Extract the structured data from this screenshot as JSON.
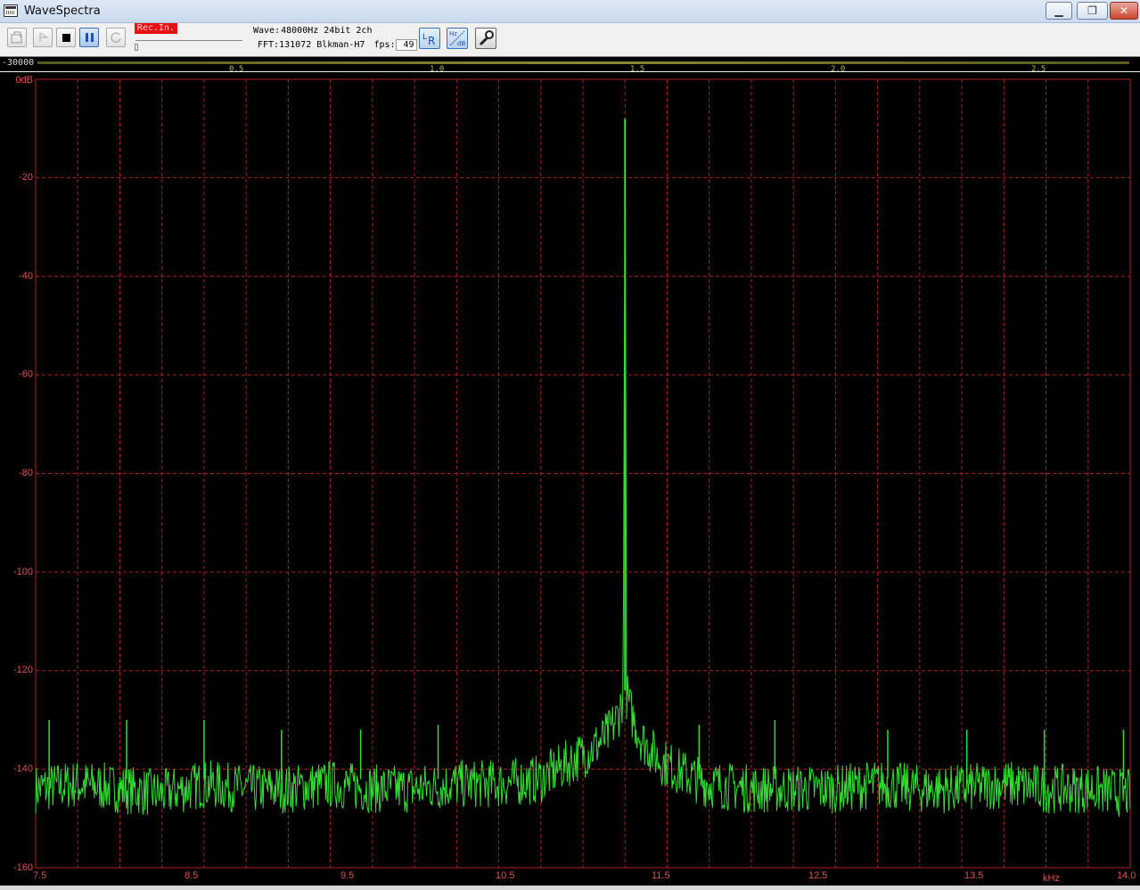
{
  "window": {
    "title": "WaveSpectra"
  },
  "toolbar": {
    "rec_in_label": "Rec.In.",
    "wave_label": "Wave:",
    "wave_value": "48000Hz 24bit 2ch",
    "fft_label": "FFT:",
    "fft_value": "131072 Blkman-H7",
    "fps_label": "fps:",
    "fps_value": "49"
  },
  "meter": {
    "level_label": "-30000",
    "ticks": [
      "0.5",
      "1.0",
      "1.5",
      "2.0",
      "2.5"
    ]
  },
  "icons": {
    "open": "open-file-icon",
    "play": "play-icon",
    "stop": "stop-icon",
    "pause": "pause-icon",
    "loop": "loop-icon",
    "lr": "lr-channel-icon",
    "hzdb": "hz-db-scale-icon",
    "settings": "wrench-icon"
  },
  "colors": {
    "trace": "#33dd33",
    "grid": "#b02020",
    "axis_text": "#e05050",
    "background": "#000000"
  },
  "chart_data": {
    "type": "line",
    "title": "",
    "xlabel": "kHz",
    "ylabel": "",
    "xlim": [
      7.5,
      14.0
    ],
    "ylim": [
      -160,
      0
    ],
    "y_unit_label": "0dB",
    "x_tick_labels": [
      "7.5",
      "8.5",
      "9.5",
      "10.5",
      "11.5",
      "12.5",
      "13.5",
      "14.0"
    ],
    "y_tick_labels": [
      "0dB",
      "-20",
      "-40",
      "-60",
      "-80",
      "-100",
      "-120",
      "-140",
      "-160"
    ],
    "grid": true,
    "series": [
      {
        "x": [
          7.5,
          7.75,
          8.0,
          8.25,
          8.5,
          8.75,
          9.0,
          9.25,
          9.5,
          9.75,
          10.0,
          10.25,
          10.5,
          10.65,
          10.8,
          10.9,
          10.96,
          10.99,
          11.0,
          11.01,
          11.04,
          11.1,
          11.2,
          11.35,
          11.5,
          11.75,
          12.0,
          12.25,
          12.5,
          12.75,
          13.0,
          13.25,
          13.5,
          13.75,
          14.0
        ],
        "y": [
          -144,
          -143,
          -144,
          -145,
          -143,
          -144,
          -144,
          -143,
          -144,
          -144,
          -143,
          -143,
          -142,
          -139,
          -136,
          -133,
          -129,
          -125,
          -8,
          -125,
          -129,
          -134,
          -138,
          -141,
          -143,
          -144,
          -144,
          -144,
          -143,
          -144,
          -144,
          -143,
          -144,
          -144,
          -145
        ]
      }
    ],
    "spurs": {
      "x": [
        7.58,
        8.04,
        8.5,
        8.96,
        9.43,
        9.89,
        11.44,
        11.89,
        12.56,
        13.03,
        13.49,
        13.96
      ],
      "y": [
        -130,
        -130,
        -130,
        -132,
        -132,
        -131,
        -131,
        -130,
        -132,
        -132,
        -132,
        -132
      ]
    },
    "legend": "none"
  }
}
